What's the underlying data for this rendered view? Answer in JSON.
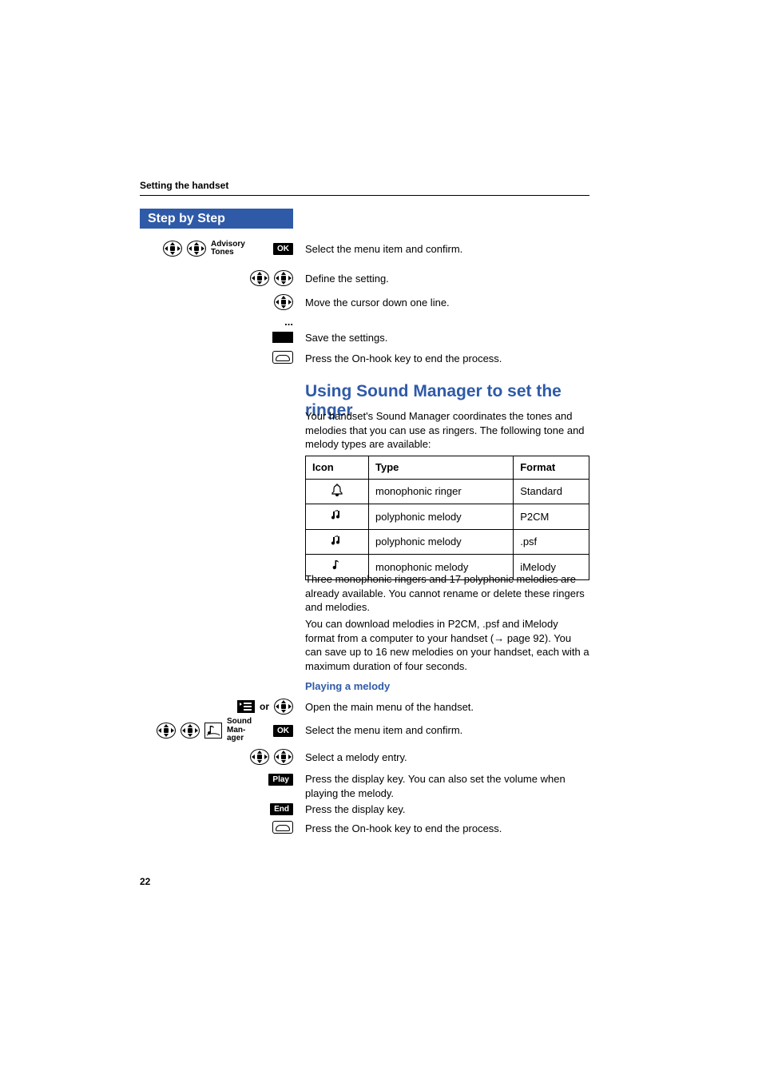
{
  "header": {
    "running": "Setting the handset"
  },
  "step_header": "Step by Step",
  "rows": {
    "advisory": {
      "label": "Advisory Tones",
      "ok": "OK",
      "desc": "Select the menu item and confirm."
    },
    "define": {
      "desc": "Define the setting."
    },
    "move": {
      "desc": "Move the cursor down one line."
    },
    "dots": "...",
    "save": {
      "desc": "Save the settings."
    },
    "onhook1": {
      "desc": "Press the On-hook key to end the process."
    }
  },
  "section": {
    "title": "Using Sound Manager to set the ringer",
    "intro": "Your handset's Sound Manager coordinates the tones and melodies that you can use as ringers. The following tone and melody types are available:",
    "table": {
      "headers": [
        "Icon",
        "Type",
        "Format"
      ],
      "rows": [
        {
          "icon": "bell",
          "type": "monophonic ringer",
          "format": "Standard"
        },
        {
          "icon": "notes",
          "type": "polyphonic melody",
          "format": "P2CM"
        },
        {
          "icon": "notes",
          "type": "polyphonic melody",
          "format": ".psf"
        },
        {
          "icon": "note",
          "type": "monophonic melody",
          "format": "iMelody"
        }
      ]
    },
    "after1": "Three monophonic ringers and 17 polyphonic melodies are already available. You cannot rename or delete these ringers and melodies.",
    "after2_a": "You can download melodies in P2CM, .psf and iMelody format from a computer to your handset (",
    "after2_arrow": "→",
    "after2_b": " page 92). You can save up to 16 new melodies on your handset, each with a maximum duration of four seconds."
  },
  "playing": {
    "heading": "Playing a melody",
    "open": {
      "or": "or",
      "desc": "Open the main menu of the handset."
    },
    "sound": {
      "label": "Sound Man-\nager",
      "ok": "OK",
      "desc": "Select the menu item and confirm."
    },
    "select": {
      "desc": "Select a melody entry."
    },
    "play": {
      "btn": "Play",
      "desc": "Press the display key. You can also set the volume when playing the melody."
    },
    "end": {
      "btn": "End",
      "desc": "Press the display key."
    },
    "onhook": {
      "desc": "Press the On-hook key to end the process."
    }
  },
  "page_number": "22"
}
